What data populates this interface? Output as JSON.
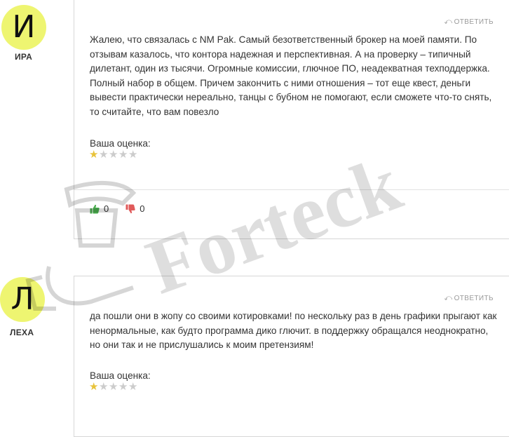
{
  "comments": [
    {
      "avatar_letter": "И",
      "author": "ИРА",
      "reply_label": "ОТВЕТИТЬ",
      "text": "Жалею, что связалась с NM Pak. Самый безответственный брокер на моей памяти. По отзывам казалось, что контора надежная и перспективная. А на проверку – типичный дилетант, один из тысячи. Огромные комиссии, глючное ПО, неадекватная техподдержка. Полный набор в общем. Причем закончить с ними отношения – тот еще квест, деньги вывести практически нереально, танцы с бубном не помогают, если сможете что-то снять, то считайте, что вам повезло",
      "rating_label": "Ваша оценка:",
      "rating": 1,
      "rating_max": 5,
      "likes": "0",
      "dislikes": "0"
    },
    {
      "avatar_letter": "Л",
      "author": "ЛЕХА",
      "reply_label": "ОТВЕТИТЬ",
      "text": "да пошли они в жопу со своими котировками! по нескольку раз в день графики прыгают как ненормальные, как будто программа дико глючит. в поддержку обращался неоднократно, но они так и не прислушались к моим претензиям!",
      "rating_label": "Ваша оценка:",
      "rating": 1,
      "rating_max": 5
    }
  ],
  "watermark": "Forteck",
  "colors": {
    "avatar_bg": "#eef571",
    "star": "#e8c33a",
    "like": "#4caf50",
    "dislike": "#e05a5a"
  }
}
